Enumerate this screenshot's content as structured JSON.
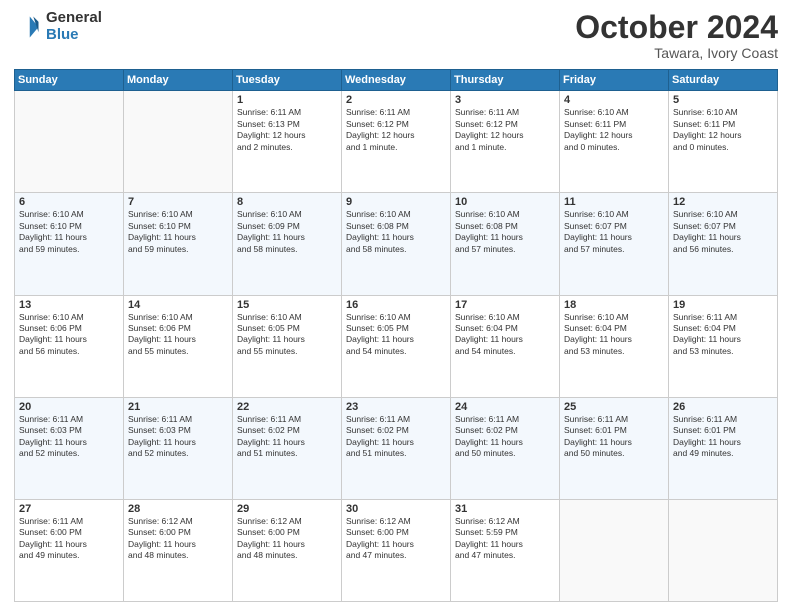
{
  "header": {
    "logo": {
      "line1": "General",
      "line2": "Blue"
    },
    "title": "October 2024",
    "subtitle": "Tawara, Ivory Coast"
  },
  "days_of_week": [
    "Sunday",
    "Monday",
    "Tuesday",
    "Wednesday",
    "Thursday",
    "Friday",
    "Saturday"
  ],
  "weeks": [
    [
      {
        "day": "",
        "info": ""
      },
      {
        "day": "",
        "info": ""
      },
      {
        "day": "1",
        "info": "Sunrise: 6:11 AM\nSunset: 6:13 PM\nDaylight: 12 hours\nand 2 minutes."
      },
      {
        "day": "2",
        "info": "Sunrise: 6:11 AM\nSunset: 6:12 PM\nDaylight: 12 hours\nand 1 minute."
      },
      {
        "day": "3",
        "info": "Sunrise: 6:11 AM\nSunset: 6:12 PM\nDaylight: 12 hours\nand 1 minute."
      },
      {
        "day": "4",
        "info": "Sunrise: 6:10 AM\nSunset: 6:11 PM\nDaylight: 12 hours\nand 0 minutes."
      },
      {
        "day": "5",
        "info": "Sunrise: 6:10 AM\nSunset: 6:11 PM\nDaylight: 12 hours\nand 0 minutes."
      }
    ],
    [
      {
        "day": "6",
        "info": "Sunrise: 6:10 AM\nSunset: 6:10 PM\nDaylight: 11 hours\nand 59 minutes."
      },
      {
        "day": "7",
        "info": "Sunrise: 6:10 AM\nSunset: 6:10 PM\nDaylight: 11 hours\nand 59 minutes."
      },
      {
        "day": "8",
        "info": "Sunrise: 6:10 AM\nSunset: 6:09 PM\nDaylight: 11 hours\nand 58 minutes."
      },
      {
        "day": "9",
        "info": "Sunrise: 6:10 AM\nSunset: 6:08 PM\nDaylight: 11 hours\nand 58 minutes."
      },
      {
        "day": "10",
        "info": "Sunrise: 6:10 AM\nSunset: 6:08 PM\nDaylight: 11 hours\nand 57 minutes."
      },
      {
        "day": "11",
        "info": "Sunrise: 6:10 AM\nSunset: 6:07 PM\nDaylight: 11 hours\nand 57 minutes."
      },
      {
        "day": "12",
        "info": "Sunrise: 6:10 AM\nSunset: 6:07 PM\nDaylight: 11 hours\nand 56 minutes."
      }
    ],
    [
      {
        "day": "13",
        "info": "Sunrise: 6:10 AM\nSunset: 6:06 PM\nDaylight: 11 hours\nand 56 minutes."
      },
      {
        "day": "14",
        "info": "Sunrise: 6:10 AM\nSunset: 6:06 PM\nDaylight: 11 hours\nand 55 minutes."
      },
      {
        "day": "15",
        "info": "Sunrise: 6:10 AM\nSunset: 6:05 PM\nDaylight: 11 hours\nand 55 minutes."
      },
      {
        "day": "16",
        "info": "Sunrise: 6:10 AM\nSunset: 6:05 PM\nDaylight: 11 hours\nand 54 minutes."
      },
      {
        "day": "17",
        "info": "Sunrise: 6:10 AM\nSunset: 6:04 PM\nDaylight: 11 hours\nand 54 minutes."
      },
      {
        "day": "18",
        "info": "Sunrise: 6:10 AM\nSunset: 6:04 PM\nDaylight: 11 hours\nand 53 minutes."
      },
      {
        "day": "19",
        "info": "Sunrise: 6:11 AM\nSunset: 6:04 PM\nDaylight: 11 hours\nand 53 minutes."
      }
    ],
    [
      {
        "day": "20",
        "info": "Sunrise: 6:11 AM\nSunset: 6:03 PM\nDaylight: 11 hours\nand 52 minutes."
      },
      {
        "day": "21",
        "info": "Sunrise: 6:11 AM\nSunset: 6:03 PM\nDaylight: 11 hours\nand 52 minutes."
      },
      {
        "day": "22",
        "info": "Sunrise: 6:11 AM\nSunset: 6:02 PM\nDaylight: 11 hours\nand 51 minutes."
      },
      {
        "day": "23",
        "info": "Sunrise: 6:11 AM\nSunset: 6:02 PM\nDaylight: 11 hours\nand 51 minutes."
      },
      {
        "day": "24",
        "info": "Sunrise: 6:11 AM\nSunset: 6:02 PM\nDaylight: 11 hours\nand 50 minutes."
      },
      {
        "day": "25",
        "info": "Sunrise: 6:11 AM\nSunset: 6:01 PM\nDaylight: 11 hours\nand 50 minutes."
      },
      {
        "day": "26",
        "info": "Sunrise: 6:11 AM\nSunset: 6:01 PM\nDaylight: 11 hours\nand 49 minutes."
      }
    ],
    [
      {
        "day": "27",
        "info": "Sunrise: 6:11 AM\nSunset: 6:00 PM\nDaylight: 11 hours\nand 49 minutes."
      },
      {
        "day": "28",
        "info": "Sunrise: 6:12 AM\nSunset: 6:00 PM\nDaylight: 11 hours\nand 48 minutes."
      },
      {
        "day": "29",
        "info": "Sunrise: 6:12 AM\nSunset: 6:00 PM\nDaylight: 11 hours\nand 48 minutes."
      },
      {
        "day": "30",
        "info": "Sunrise: 6:12 AM\nSunset: 6:00 PM\nDaylight: 11 hours\nand 47 minutes."
      },
      {
        "day": "31",
        "info": "Sunrise: 6:12 AM\nSunset: 5:59 PM\nDaylight: 11 hours\nand 47 minutes."
      },
      {
        "day": "",
        "info": ""
      },
      {
        "day": "",
        "info": ""
      }
    ]
  ]
}
